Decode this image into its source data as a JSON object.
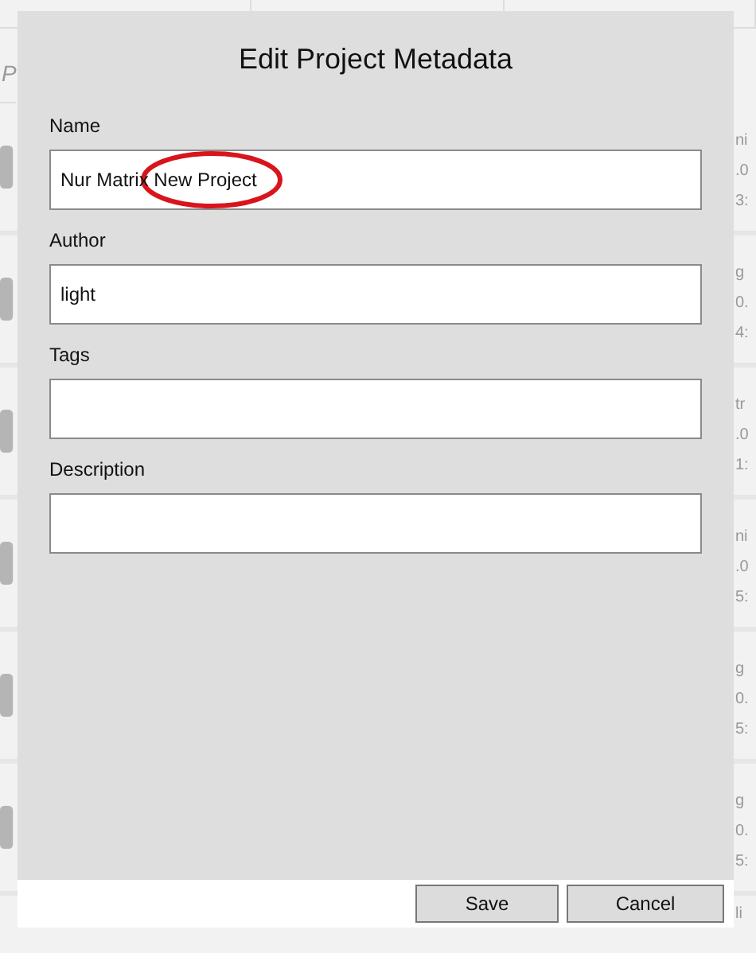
{
  "search": {
    "placeholder": "P"
  },
  "projects": [
    {
      "lines": [
        "ni",
        ".0",
        "3:"
      ]
    },
    {
      "lines": [
        "g",
        "0.",
        "4:"
      ]
    },
    {
      "lines": [
        "tr",
        ".0",
        "1:"
      ]
    },
    {
      "lines": [
        "ni",
        ".0",
        "5:"
      ]
    },
    {
      "lines": [
        "g",
        "0.",
        "5:"
      ]
    },
    {
      "lines": [
        "g",
        "0.",
        "5:"
      ]
    }
  ],
  "next_project": {
    "side": "li"
  },
  "dialog": {
    "title": "Edit Project Metadata",
    "fields": [
      {
        "label": "Name",
        "value": "Nur Matrix New Project",
        "circled": true
      },
      {
        "label": "Author",
        "value": "light",
        "circled": false
      },
      {
        "label": "Tags",
        "circled": false
      },
      {
        "label": "Description",
        "circled": false
      }
    ],
    "buttons": [
      "Save",
      "Cancel"
    ]
  }
}
